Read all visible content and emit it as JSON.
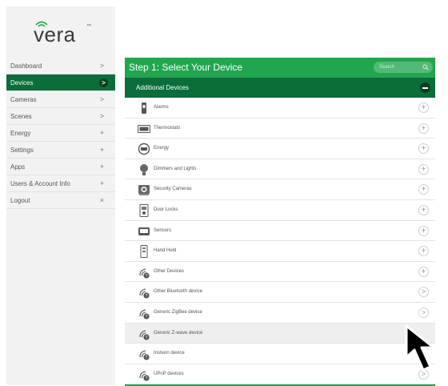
{
  "logo": {
    "text": "vera",
    "trademark": "™"
  },
  "sidebar": {
    "items": [
      {
        "label": "Dashboard",
        "symbol": ">",
        "active": false
      },
      {
        "label": "Devices",
        "symbol": ">",
        "active": true
      },
      {
        "label": "Cameras",
        "symbol": ">",
        "active": false
      },
      {
        "label": "Scenes",
        "symbol": ">",
        "active": false
      },
      {
        "label": "Energy",
        "symbol": "+",
        "active": false
      },
      {
        "label": "Settings",
        "symbol": "+",
        "active": false
      },
      {
        "label": "Apps",
        "symbol": "+",
        "active": false
      },
      {
        "label": "Users & Account Info",
        "symbol": "+",
        "active": false
      },
      {
        "label": "Logout",
        "symbol": "×",
        "active": false
      }
    ]
  },
  "main": {
    "step_title": "Step 1: Select Your Device",
    "search": {
      "placeholder": "Search"
    },
    "section_title": "Additional Devices",
    "devices": [
      {
        "label": "Alarms",
        "icon": "alarm-icon",
        "action": "+"
      },
      {
        "label": "Thermostats",
        "icon": "thermostat-icon",
        "action": "+"
      },
      {
        "label": "Energy",
        "icon": "energy-meter-icon",
        "action": "+"
      },
      {
        "label": "Dimmers and Lights",
        "icon": "bulb-icon",
        "action": "+"
      },
      {
        "label": "Security Cameras",
        "icon": "camera-icon",
        "action": "+"
      },
      {
        "label": "Door Locks",
        "icon": "door-lock-icon",
        "action": "+"
      },
      {
        "label": "Sensors",
        "icon": "sensor-icon",
        "action": "+"
      },
      {
        "label": "Hand Held",
        "icon": "remote-icon",
        "action": "+"
      },
      {
        "label": "Other Devices",
        "icon": "wireless-device-icon",
        "action": "+"
      },
      {
        "label": "Other Bluetooth device",
        "icon": "wireless-device-icon",
        "action": ">"
      },
      {
        "label": "Generic ZigBee device",
        "icon": "wireless-device-icon",
        "action": ">"
      },
      {
        "label": "Generic Z-wave device",
        "icon": "wireless-device-icon",
        "action": ""
      },
      {
        "label": "Insteon device",
        "icon": "wireless-device-icon",
        "action": ""
      },
      {
        "label": "UPnP devices",
        "icon": "wireless-device-icon",
        "action": ">"
      }
    ]
  },
  "colors": {
    "accent": "#21a64f",
    "dark_accent": "#0b6e3a"
  }
}
